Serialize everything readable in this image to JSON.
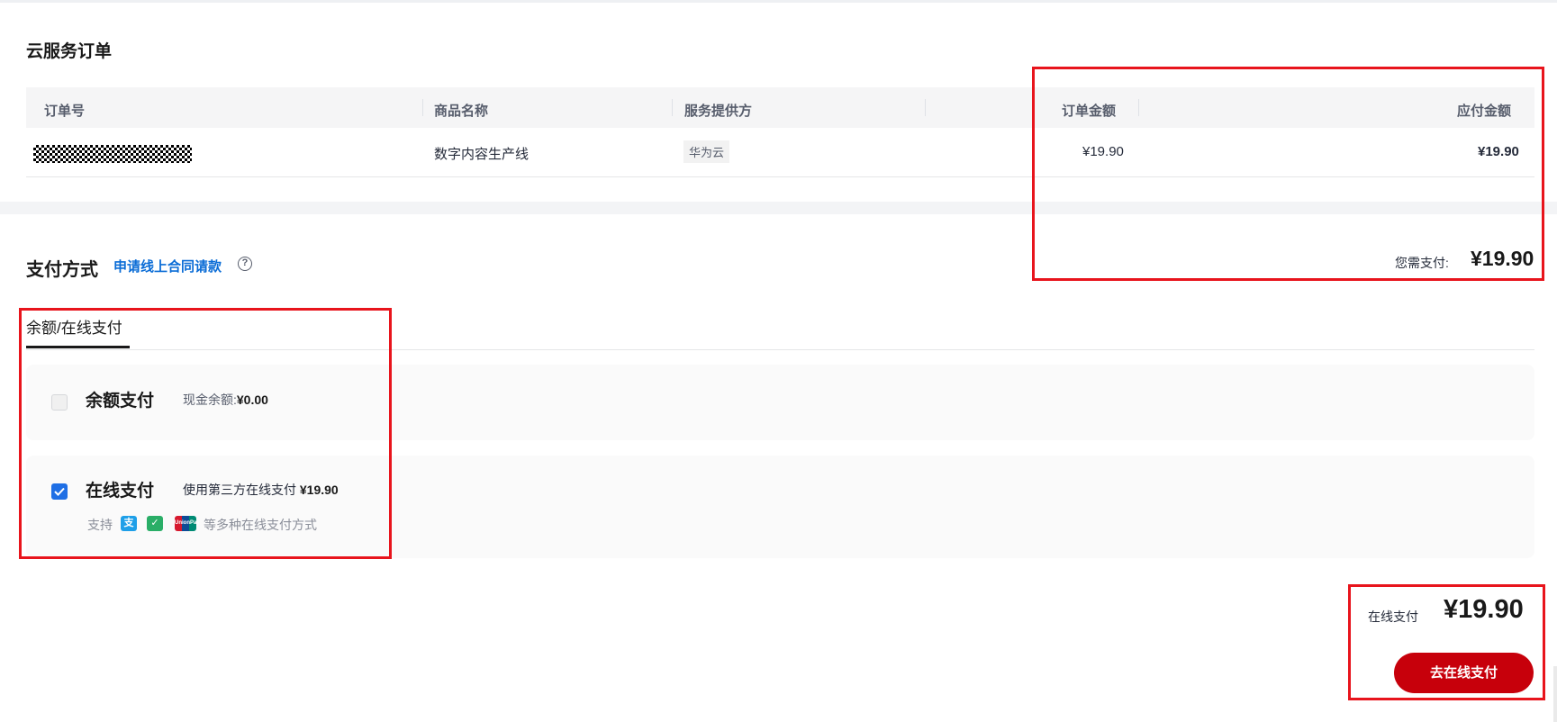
{
  "order_section": {
    "title": "云服务订单",
    "columns": [
      "订单号",
      "商品名称",
      "服务提供方",
      "订单金额",
      "应付金额"
    ],
    "row": {
      "product_name": "数字内容生产线",
      "provider": "华为云",
      "order_amount": "¥19.90",
      "payable_amount": "¥19.90"
    }
  },
  "payment_section": {
    "title": "支付方式",
    "contract_link": "申请线上合同请款",
    "help_icon": "?",
    "need_pay_label": "您需支付:",
    "need_pay_amount": "¥19.90",
    "tab_label": "余额/在线支付",
    "balance_option": {
      "title": "余额支付",
      "desc_label": "现金余额:",
      "desc_value": "¥0.00",
      "checked": false
    },
    "online_option": {
      "title": "在线支付",
      "desc_label": "使用第三方在线支付",
      "desc_value": "¥19.90",
      "checked": true,
      "support_prefix": "支持",
      "support_suffix": "等多种在线支付方式",
      "pay_icons": [
        {
          "name": "alipay-icon",
          "glyph": "支"
        },
        {
          "name": "wechat-pay-icon",
          "glyph": "✓"
        },
        {
          "name": "unionpay-icon",
          "glyph": "UnionPay"
        }
      ]
    }
  },
  "footer": {
    "online_pay_label": "在线支付",
    "online_pay_amount": "¥19.90",
    "go_pay_button": "去在线支付"
  },
  "colors": {
    "primary_button": "#c7000b",
    "link": "#0a6cd6",
    "checkbox_checked": "#1f6fe5",
    "annotation_box": "#e8141c"
  }
}
